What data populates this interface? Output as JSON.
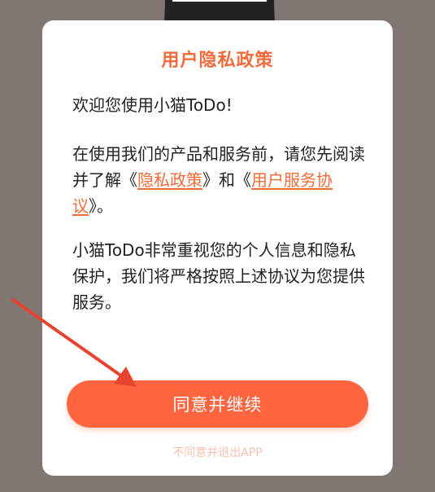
{
  "dialog": {
    "title": "用户隐私政策",
    "greeting": "欢迎您使用小猫ToDo!",
    "intro_prefix": "在使用我们的产品和服务前，请您先阅读并了解《",
    "privacy_link": "隐私政策",
    "intro_middle": "》和《",
    "terms_link": "用户服务协议",
    "intro_suffix": "》。",
    "commitment": "小猫ToDo非常重视您的个人信息和隐私保护，我们将严格按照上述协议为您提供服务。",
    "agree_label": "同意并继续",
    "exit_label": "不同意并退出APP"
  },
  "colors": {
    "accent": "#f26b3a",
    "button": "#ff6640",
    "overlay": "#807773",
    "annotation_arrow": "#e8432e"
  }
}
